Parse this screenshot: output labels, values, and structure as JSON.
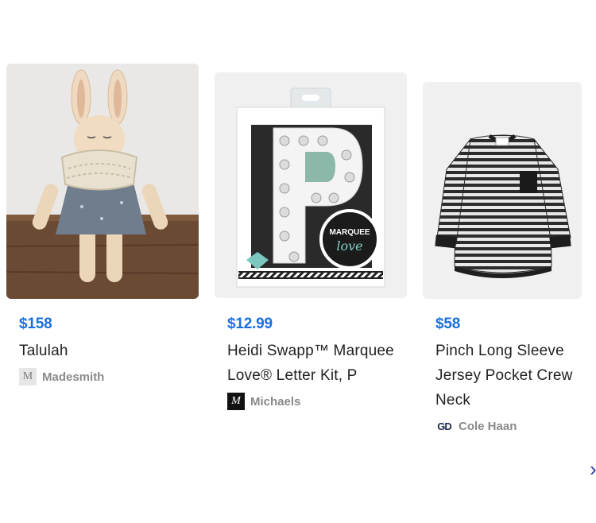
{
  "products": [
    {
      "price": "$158",
      "title": "Talulah",
      "seller": {
        "name": "Madesmith",
        "logo_glyph": "M",
        "logo": "madesmith-logo"
      },
      "image": "bunny-doll-toy"
    },
    {
      "price": "$12.99",
      "title": "Heidi Swapp™ Marquee Love® Letter Kit, P",
      "seller": {
        "name": "Michaels",
        "logo_glyph": "M",
        "logo": "michaels-logo"
      },
      "image": "marquee-letter-kit",
      "package_text": "MARQUEE love"
    },
    {
      "price": "$58",
      "title": "Pinch Long Sleeve Jersey Pocket Crew Neck",
      "seller": {
        "name": "Cole Haan",
        "logo_glyph": "GD",
        "logo": "cole-haan-logo"
      },
      "image": "striped-long-sleeve-shirt"
    }
  ],
  "carousel": {
    "next_icon": "chevron-right-icon",
    "glyph": "›"
  },
  "colors": {
    "price": "#1a6fe0",
    "title": "#222222",
    "seller": "#8a8a8a",
    "image_bg": "#f0f0f0"
  }
}
